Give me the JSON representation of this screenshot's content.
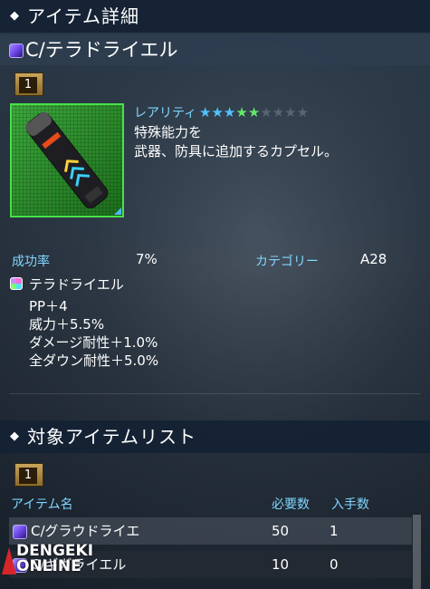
{
  "header": {
    "title": "アイテム詳細"
  },
  "item": {
    "name": "C/テラドライエル",
    "quantity": "1",
    "rarity_label": "レアリティ",
    "rarity": {
      "filled": 5,
      "total": 9,
      "colors": [
        "#4fc3ff",
        "#4fc3ff",
        "#4fc3ff",
        "#62e86a",
        "#62e86a"
      ]
    },
    "description": [
      "特殊能力を",
      "武器、防具に追加するカプセル。"
    ],
    "success_label": "成功率",
    "success_value": "7%",
    "category_label": "カテゴリー",
    "category_value": "A28",
    "ability_name": "テラドライエル",
    "ability_stats": [
      "PP＋4",
      "威力＋5.5%",
      "ダメージ耐性＋1.0%",
      "全ダウン耐性＋5.0%"
    ]
  },
  "target_section": {
    "title": "対象アイテムリスト",
    "quantity": "1",
    "columns": {
      "name": "アイテム名",
      "required": "必要数",
      "obtained": "入手数"
    },
    "rows": [
      {
        "name": "C/グラウドライエ",
        "required": "50",
        "obtained": "1"
      },
      {
        "name": "C/ギガライエル",
        "required": "10",
        "obtained": "0"
      }
    ]
  },
  "watermark": {
    "line1": "DENGEKI",
    "line2": "ONLINE"
  }
}
